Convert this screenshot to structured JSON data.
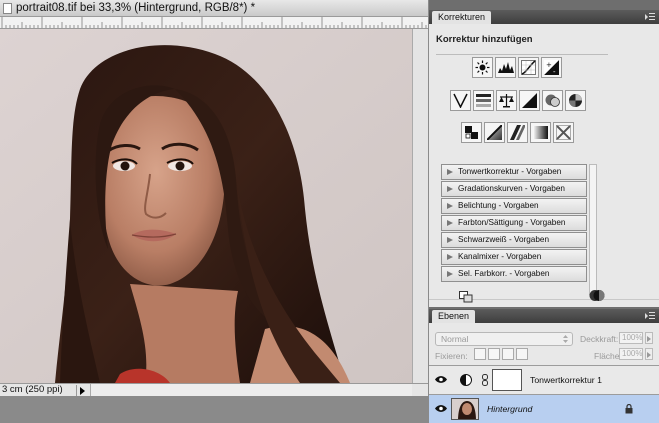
{
  "document": {
    "title": "portrait08.tif bei 33,3% (Hintergrund, RGB/8*) *",
    "status": "3 cm (250 ppi)"
  },
  "adjustments_panel": {
    "tab_label": "Korrekturen",
    "heading": "Korrektur hinzufügen",
    "icon_rows": [
      [
        "brightness-contrast-icon",
        "levels-icon",
        "curves-icon",
        "exposure-icon"
      ],
      [
        "vibrance-icon",
        "hue-saturation-icon",
        "color-balance-icon",
        "black-white-icon",
        "photo-filter-icon",
        "channel-mixer-icon"
      ],
      [
        "invert-icon",
        "posterize-icon",
        "threshold-icon",
        "gradient-map-icon",
        "selective-color-icon"
      ]
    ],
    "presets": [
      "Tonwertkorrektur - Vorgaben",
      "Gradationskurven - Vorgaben",
      "Belichtung - Vorgaben",
      "Farbton/Sättigung - Vorgaben",
      "Schwarzweiß - Vorgaben",
      "Kanalmixer - Vorgaben",
      "Sel. Farbkorr. - Vorgaben"
    ]
  },
  "layers_panel": {
    "tab_label": "Ebenen",
    "blend_mode": "Normal",
    "opacity_label": "Deckkraft:",
    "opacity_value": "100%",
    "lock_label": "Fixieren:",
    "fill_label": "Fläche:",
    "fill_value": "100%",
    "layers": [
      {
        "name": "Tonwertkorrektur 1",
        "type": "adjustment",
        "selected": false
      },
      {
        "name": "Hintergrund",
        "type": "image",
        "selected": true,
        "locked": true
      }
    ]
  },
  "colors": {
    "panel_bg": "#e8e8e8",
    "selected_layer": "#b8cff0",
    "canvas_bg": "#d7cecc"
  }
}
